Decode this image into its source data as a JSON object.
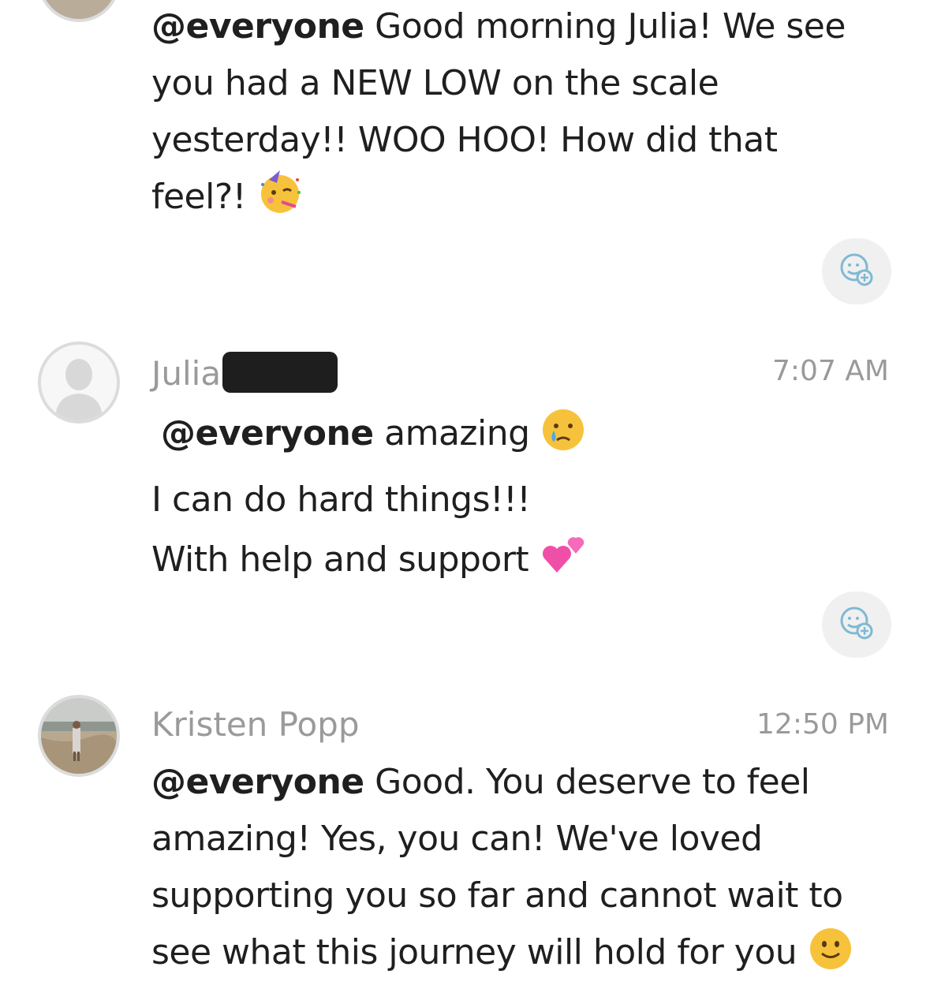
{
  "messages": [
    {
      "mention": "@everyone",
      "lines": [
        " Good morning Julia! We see",
        "you had a NEW LOW on the scale",
        "yesterday!! WOO HOO! How did that",
        "feel?! "
      ],
      "emoji": "partying-face-emoji"
    },
    {
      "author": "Julia",
      "timestamp": "7:07 AM",
      "mention": "@everyone",
      "lines": [
        " amazing ",
        "I can do hard things!!!",
        "With help and support "
      ],
      "emojis": [
        "crying-face-emoji",
        "two-hearts-emoji"
      ]
    },
    {
      "author": "Kristen Popp",
      "timestamp": "12:50 PM",
      "mention": "@everyone",
      "lines": [
        " Good. You deserve to feel",
        "amazing! Yes, you can! We've loved",
        "supporting you so far and cannot wait to",
        "see what this journey will hold for you "
      ],
      "emoji": "slightly-smiling-face-emoji"
    }
  ],
  "icons": {
    "react": "add-reaction-icon",
    "default_avatar": "default-avatar-icon",
    "photo_avatar": "user-photo-avatar"
  },
  "colors": {
    "author": "#9a9a9a",
    "timestamp": "#9a9a9a",
    "react_bg": "#f0f0f0",
    "react_icon": "#6fb6d6"
  }
}
